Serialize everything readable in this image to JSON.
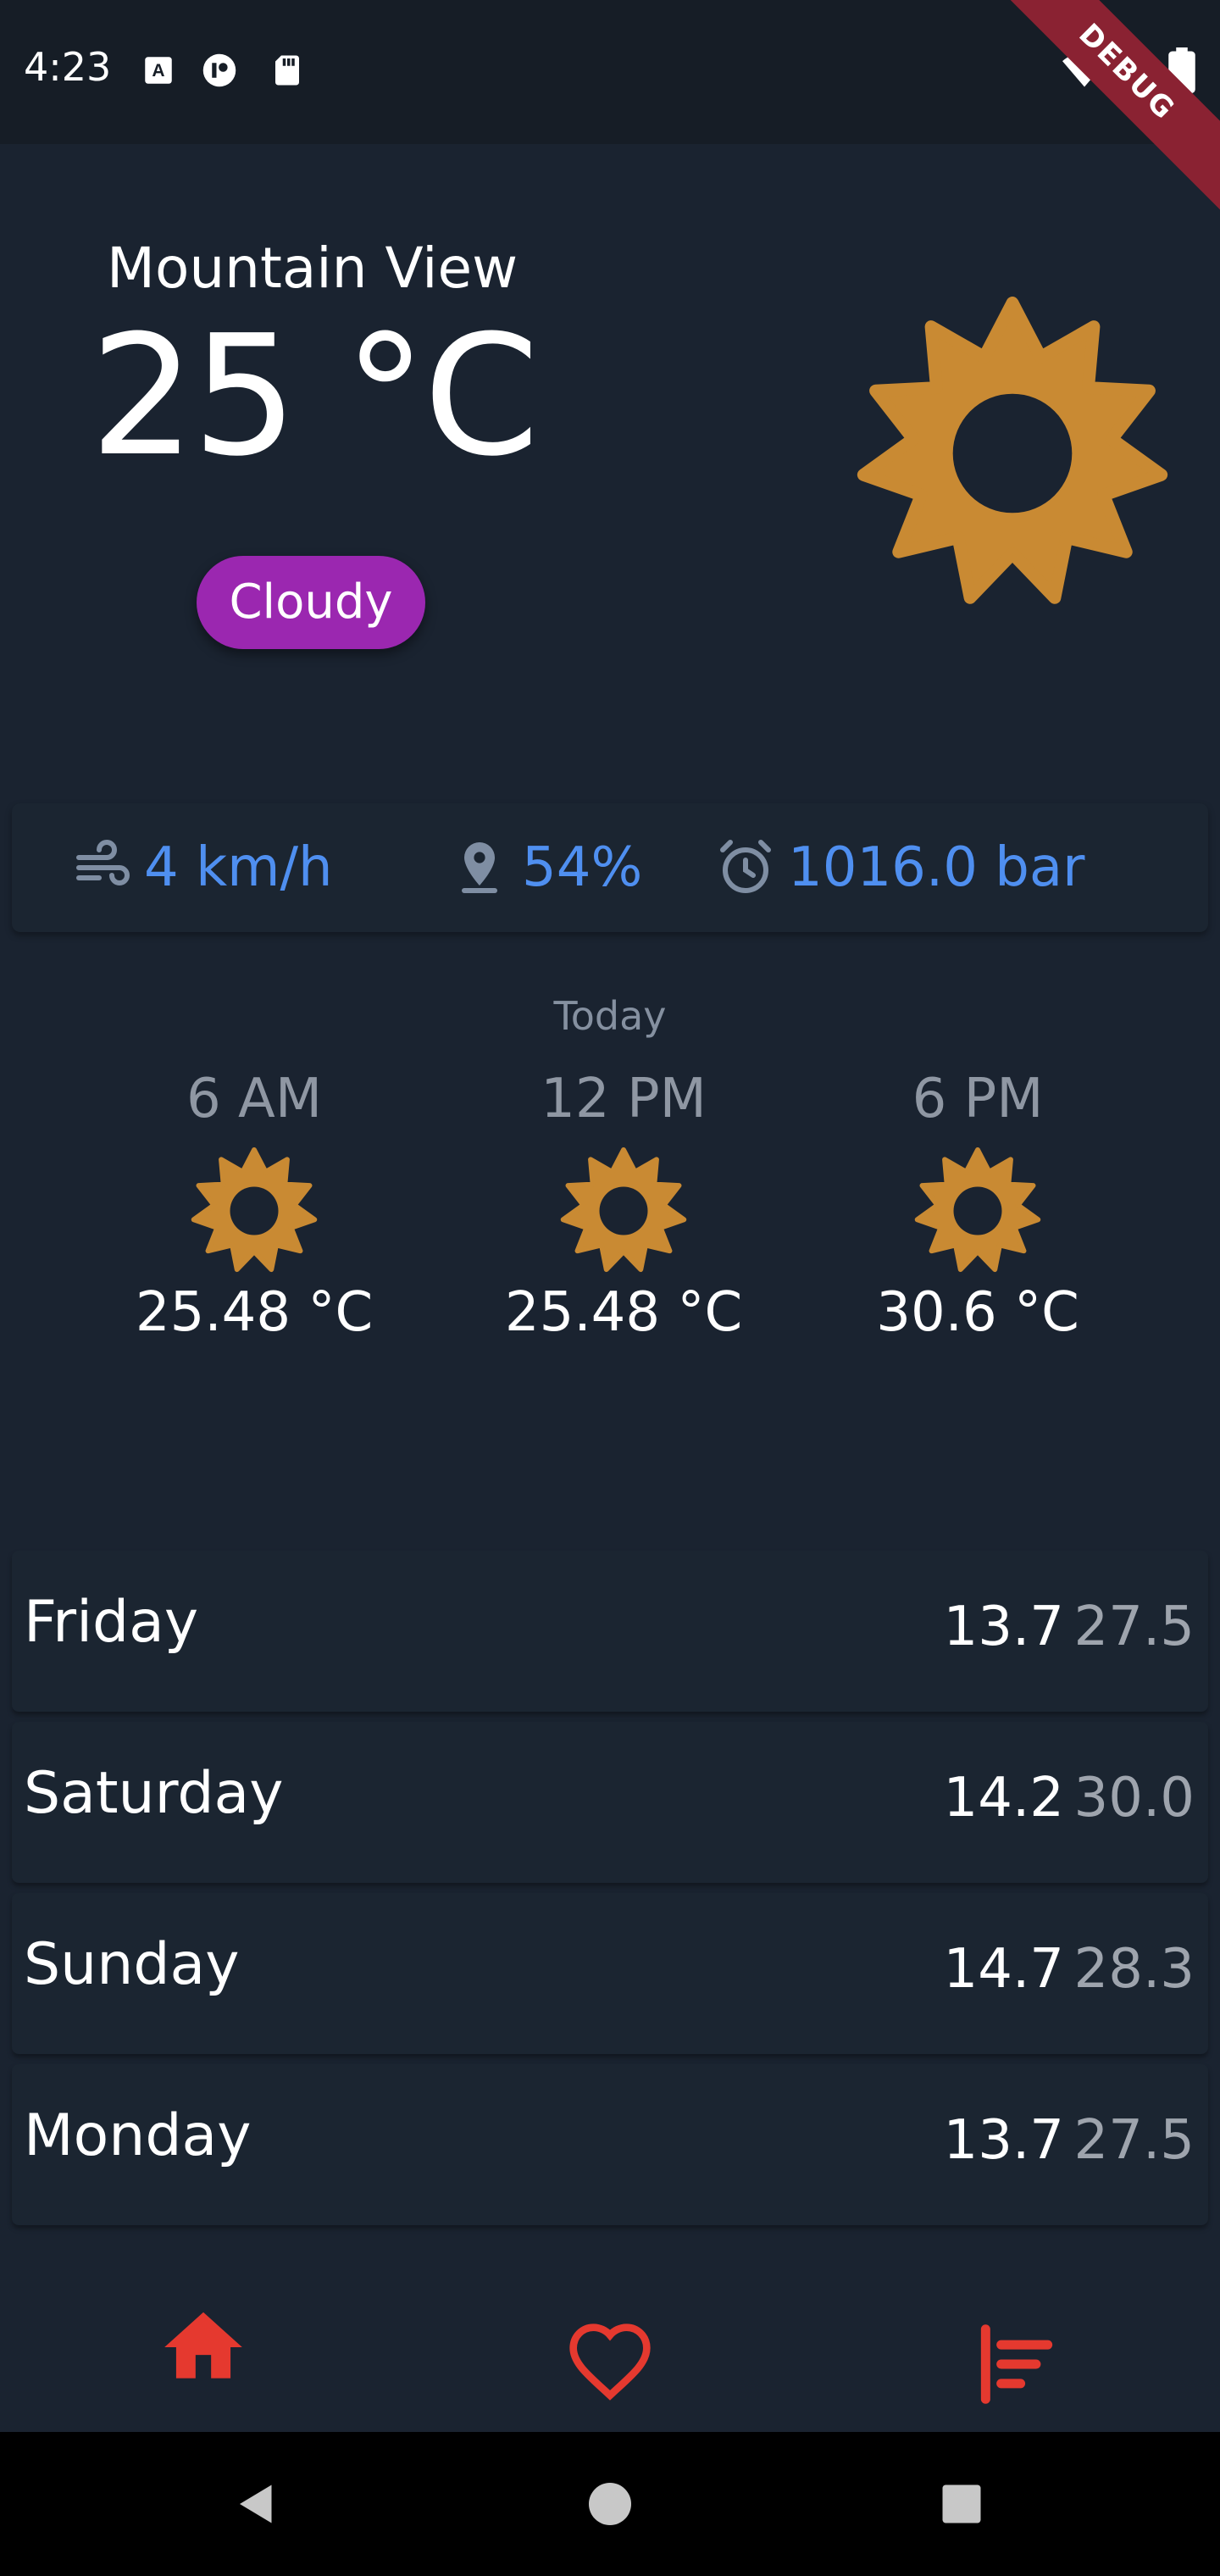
{
  "status_bar": {
    "time": "4:23",
    "debug_label": "DEBUG"
  },
  "current": {
    "city": "Mountain View",
    "temperature": "25 °C",
    "condition": "Cloudy"
  },
  "stats": {
    "wind": "4 km/h",
    "humidity": "54%",
    "pressure": "1016.0 bar"
  },
  "today": {
    "label": "Today",
    "hours": [
      {
        "time": "6 AM",
        "temp": "25.48 °C",
        "icon": "sun-icon"
      },
      {
        "time": "12 PM",
        "temp": "25.48 °C",
        "icon": "sun-icon"
      },
      {
        "time": "6 PM",
        "temp": "30.6 °C",
        "icon": "sun-icon"
      }
    ]
  },
  "daily": [
    {
      "day": "Friday",
      "min": "13.7",
      "max": "27.5"
    },
    {
      "day": "Saturday",
      "min": "14.2",
      "max": "30.0"
    },
    {
      "day": "Sunday",
      "min": "14.7",
      "max": "28.3"
    },
    {
      "day": "Monday",
      "min": "13.7",
      "max": "27.5"
    }
  ],
  "nav": {
    "items": [
      "home-icon",
      "heart-icon",
      "sort-icon"
    ],
    "accent": "#e5392f"
  },
  "colors": {
    "background": "#1a2330",
    "sun": "#c98a33",
    "stat_blue": "#4f8ff0",
    "badge_purple": "#9b27b0"
  }
}
